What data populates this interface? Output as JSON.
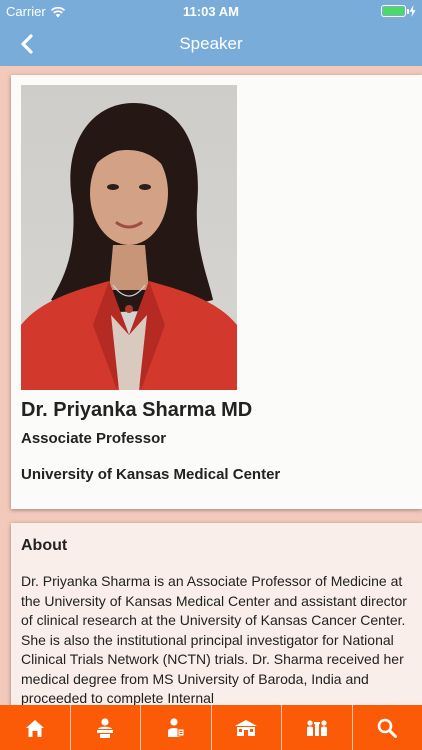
{
  "status_bar": {
    "carrier": "Carrier",
    "time": "11:03 AM"
  },
  "nav": {
    "title": "Speaker"
  },
  "speaker": {
    "name": "Dr. Priyanka Sharma MD",
    "title": "Associate Professor",
    "organization": "University of Kansas Medical Center"
  },
  "about": {
    "heading": "About",
    "text": "Dr. Priyanka Sharma is an Associate Professor of Medicine at the University of Kansas Medical Center and assistant director of clinical research at the University of Kansas Cancer Center. She is also the institutional principal investigator for National Clinical Trials Network (NCTN) trials. Dr. Sharma received her medical degree from MS University of Baroda, India and proceeded to complete Internal"
  },
  "tabbar": {
    "icons": [
      "home-icon",
      "speaker-podium-icon",
      "attendee-icon",
      "venue-icon",
      "exhibitors-icon",
      "search-icon"
    ]
  },
  "colors": {
    "header": "#79acd8",
    "background": "#f2c9bb",
    "tabbar": "#fb5b07",
    "battery": "#4cd964"
  }
}
